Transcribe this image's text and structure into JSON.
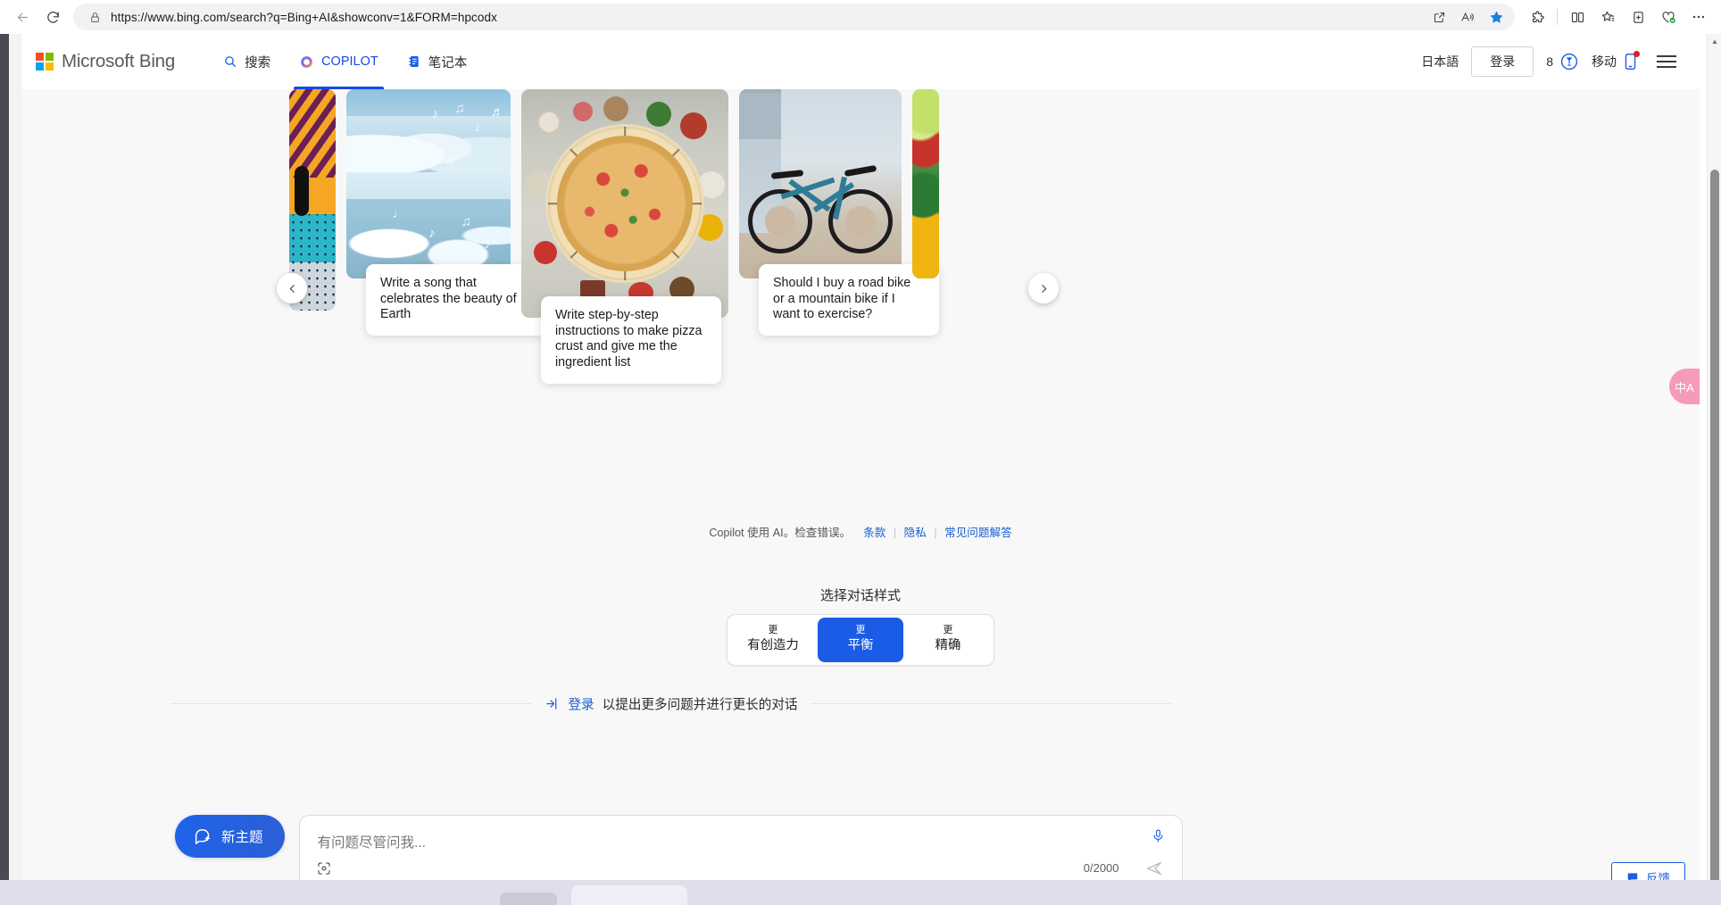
{
  "browser": {
    "url": "https://www.bing.com/search?q=Bing+AI&showconv=1&FORM=hpcodx",
    "back_label": "Back",
    "refresh_label": "Refresh",
    "lock_label": "Site information",
    "toolbar_icons": [
      "open-in-app-icon",
      "read-aloud-icon",
      "favorite-star-icon",
      "extensions-icon",
      "split-screen-icon",
      "favorites-icon",
      "collections-icon",
      "browser-essentials-icon",
      "settings-more-icon"
    ]
  },
  "header": {
    "logo_text": "Microsoft Bing",
    "logo_colors": [
      "#f25022",
      "#7fba00",
      "#00a4ef",
      "#ffb900"
    ],
    "tabs": [
      {
        "label": "搜索",
        "icon": "search-icon",
        "active": false
      },
      {
        "label": "COPILOT",
        "icon": "copilot-icon",
        "active": true
      },
      {
        "label": "笔记本",
        "icon": "notebook-icon",
        "active": false
      }
    ],
    "language": "日本語",
    "signin_label": "登录",
    "rewards_count": "8",
    "rewards_icon": "rewards-medal-icon",
    "mobile_label": "移动",
    "mobile_icon": "phone-icon",
    "menu_icon": "hamburger-menu-icon"
  },
  "carousel": {
    "prev_label": "‹",
    "next_label": "›",
    "cards": [
      {
        "caption": "",
        "art": "stripes"
      },
      {
        "caption": "Write a song that celebrates the beauty of Earth",
        "art": "ice"
      },
      {
        "caption": "Write step-by-step instructions to make pizza crust and give me the ingredient list",
        "art": "pizza"
      },
      {
        "caption": "Should I buy a road bike or a mountain bike if I want to exercise?",
        "art": "bike"
      },
      {
        "caption": "",
        "art": "veg"
      }
    ]
  },
  "disclaimer": {
    "text": "Copilot 使用 AI。检查错误。",
    "links": [
      "条款",
      "隐私",
      "常见问题解答"
    ]
  },
  "tone": {
    "title": "选择对话样式",
    "options": [
      {
        "small": "更",
        "big": "有创造力",
        "selected": false
      },
      {
        "small": "更",
        "big": "平衡",
        "selected": true
      },
      {
        "small": "更",
        "big": "精确",
        "selected": false
      }
    ],
    "selected_color": "#1a5ce6"
  },
  "signin_prompt": {
    "icon": "signin-arrow-icon",
    "link": "登录",
    "text": "以提出更多问题并进行更长的对话"
  },
  "composer": {
    "new_topic_label": "新主题",
    "new_topic_icon": "new-chat-icon",
    "placeholder": "有问题尽管问我...",
    "visual_search_icon": "visual-search-icon",
    "mic_icon": "microphone-icon",
    "char_count": "0/2000",
    "send_icon": "send-icon"
  },
  "feedback": {
    "label": "反馈",
    "icon": "feedback-bubble-icon"
  },
  "translate": {
    "label": "中A",
    "icon": "translate-icon"
  },
  "scrollbar": {
    "up_label": "▲",
    "down_label": "▼"
  }
}
